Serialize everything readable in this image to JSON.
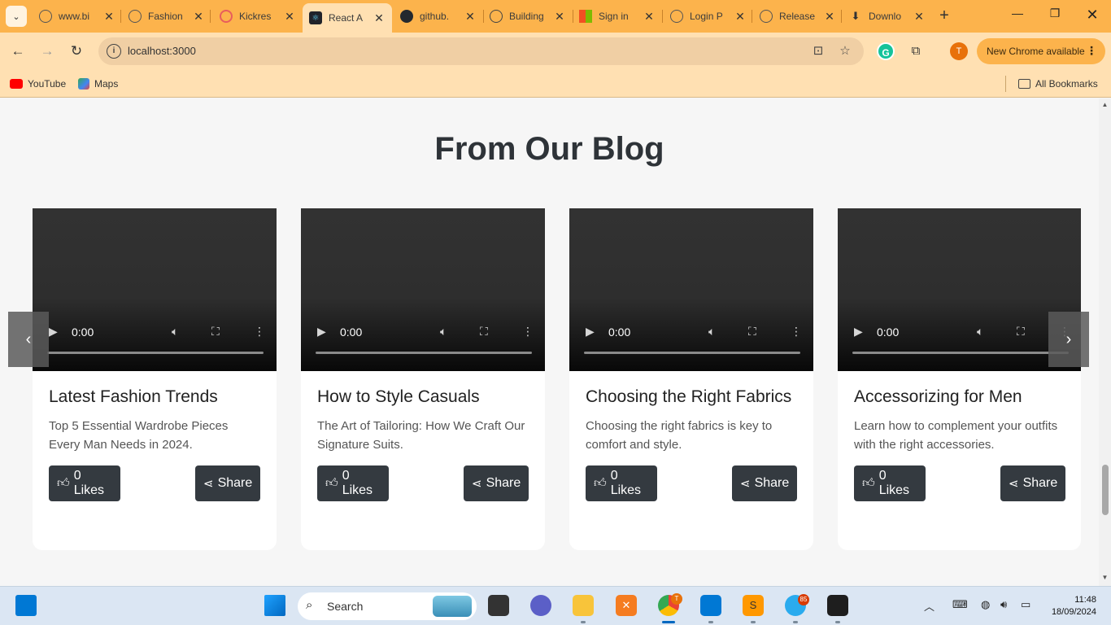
{
  "browser": {
    "tabs": [
      {
        "title": "www.bi",
        "icon": "globe-icon",
        "color": "#555555"
      },
      {
        "title": "Fashion",
        "icon": "globe-icon",
        "color": "#555555"
      },
      {
        "title": "Kickres",
        "icon": "kickresume-icon",
        "color": "#e85d5d"
      },
      {
        "title": "React A",
        "icon": "react-icon",
        "color": "#20232a"
      },
      {
        "title": "github.",
        "icon": "github-icon",
        "color": "#24292e"
      },
      {
        "title": "Building",
        "icon": "openai-icon",
        "color": "#444444"
      },
      {
        "title": "Sign in",
        "icon": "microsoft-icon",
        "color": "#f25022"
      },
      {
        "title": "Login P",
        "icon": "globe-icon",
        "color": "#555555"
      },
      {
        "title": "Release",
        "icon": "globe-icon",
        "color": "#555555"
      },
      {
        "title": "Downlo",
        "icon": "download-icon",
        "color": "#333333"
      }
    ],
    "active_tab_index": 3,
    "url": "localhost:3000",
    "new_chrome_label": "New Chrome available",
    "profile_initial": "T",
    "bookmarks": [
      {
        "label": "YouTube",
        "icon": "youtube-icon",
        "color": "#ff0000"
      },
      {
        "label": "Maps",
        "icon": "maps-icon",
        "color": "#34a853"
      }
    ],
    "all_bookmarks_label": "All Bookmarks"
  },
  "page": {
    "heading": "From Our Blog",
    "prev_arrow": "‹",
    "next_arrow": "›",
    "video_time": "0:00",
    "posts": [
      {
        "title": "Latest Fashion Trends",
        "desc": "Top 5 Essential Wardrobe Pieces Every Man Needs in 2024.",
        "likes_label": "0 Likes",
        "share_label": "Share"
      },
      {
        "title": "How to Style Casuals",
        "desc": "The Art of Tailoring: How We Craft Our Signature Suits.",
        "likes_label": "0 Likes",
        "share_label": "Share"
      },
      {
        "title": "Choosing the Right Fabrics",
        "desc": "Choosing the right fabrics is key to comfort and style.",
        "likes_label": "0 Likes",
        "share_label": "Share"
      },
      {
        "title": "Accessorizing for Men",
        "desc": "Learn how to complement your outfits with the right accessories.",
        "likes_label": "0 Likes",
        "share_label": "Share"
      }
    ]
  },
  "taskbar": {
    "search_label": "Search",
    "telegram_badge": "85",
    "time": "11:48",
    "date": "18/09/2024"
  }
}
